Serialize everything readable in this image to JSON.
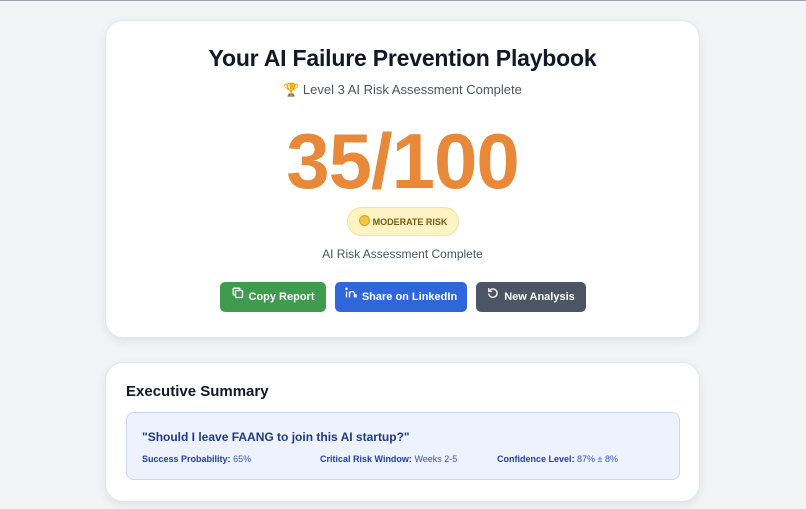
{
  "hero": {
    "title": "Your AI Failure Prevention Playbook",
    "subtitle_icon": "trophy-icon",
    "subtitle": "🏆 Level 3 AI Risk Assessment Complete",
    "score": "35/100",
    "score_value": 35,
    "score_max": 100,
    "risk_badge": "MODERATE RISK",
    "risk_badge_icon": "neutral-face-icon",
    "status": "AI Risk Assessment Complete",
    "buttons": {
      "copy": "Copy Report",
      "linkedin": "Share on LinkedIn",
      "new": "New Analysis"
    }
  },
  "summary": {
    "title": "Executive Summary",
    "question": "\"Should I leave FAANG to join this AI startup?\"",
    "metrics": [
      {
        "label": "Success Probability:",
        "value": "65%"
      },
      {
        "label": "Critical Risk Window:",
        "value": "Weeks 2-5"
      },
      {
        "label": "Confidence Level:",
        "value": "87% ± 8%"
      }
    ]
  },
  "colors": {
    "score": "#e8893a",
    "copy_button": "#3f9b4e",
    "linkedin_button": "#2f66db",
    "new_button": "#4b5563",
    "badge_bg": "#fdf3c4",
    "summary_box_bg": "#eef2fd"
  }
}
